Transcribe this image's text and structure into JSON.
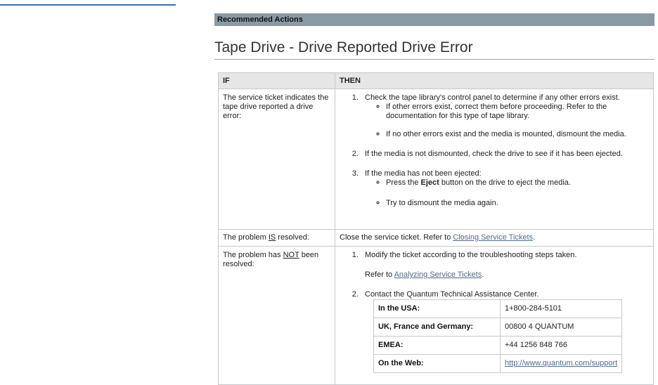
{
  "section_header": "Recommended Actions",
  "page_title": "Tape Drive - Drive Reported Drive Error",
  "table": {
    "headers": {
      "if": "IF",
      "then": "THEN"
    },
    "row1": {
      "if": "The service ticket indicates the tape drive reported a drive error:",
      "step1": "Check the tape library's control panel to determine if any other errors exist.",
      "step1_sub1": "If other errors exist, correct them before proceeding. Refer to the documentation for this type of tape library.",
      "step1_sub2": "If no other errors exist and the media is mounted, dismount the media.",
      "step2": "If the media is not dismounted, check the drive to see if it has been ejected.",
      "step3": "If the media has not been ejected:",
      "step3_sub1_pre": "Press the ",
      "step3_sub1_bold": "Eject",
      "step3_sub1_post": " button on the drive to eject the media.",
      "step3_sub2": "Try to dismount the media again."
    },
    "row2": {
      "if_pre": "The problem ",
      "if_u": "IS",
      "if_post": " resolved:",
      "then_pre": "Close the service ticket. Refer to ",
      "then_link": "Closing Service Tickets",
      "then_post": "."
    },
    "row3": {
      "if_pre": "The problem has ",
      "if_u": "NOT",
      "if_post": " been resolved:",
      "step1": "Modify the ticket according to the troubleshooting steps taken.",
      "refer_pre": "Refer to ",
      "refer_link": "Analyzing Service Tickets",
      "refer_post": ".",
      "step2": "Contact the Quantum Technical Assistance Center.",
      "contacts": [
        {
          "label": "In the USA:",
          "value": "1+800-284-5101"
        },
        {
          "label": "UK, France and Germany:",
          "value": "00800 4 QUANTUM"
        },
        {
          "label": "EMEA:",
          "value": "+44 1256 848 766"
        },
        {
          "label": "On the Web:",
          "value": "http://www.quantum.com/support"
        }
      ]
    }
  }
}
